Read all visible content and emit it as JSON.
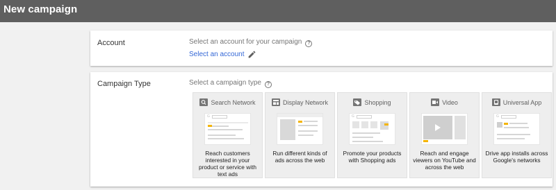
{
  "header": {
    "title": "New campaign"
  },
  "account": {
    "label": "Account",
    "prompt": "Select an account for your campaign",
    "link": "Select an account",
    "edit_icon": "pencil-icon"
  },
  "campaign_type": {
    "label": "Campaign Type",
    "prompt": "Select a campaign type",
    "types": [
      {
        "name": "Search Network",
        "icon": "search-icon",
        "description": "Reach customers interested in your product or service with text ads"
      },
      {
        "name": "Display Network",
        "icon": "display-icon",
        "description": "Run different kinds of ads across the web"
      },
      {
        "name": "Shopping",
        "icon": "shopping-tag-icon",
        "description": "Promote your products with Shopping ads"
      },
      {
        "name": "Video",
        "icon": "video-camera-icon",
        "description": "Reach and engage viewers on YouTube and across the web"
      },
      {
        "name": "Universal App",
        "icon": "app-icon",
        "description": "Drive app installs across Google's networks"
      }
    ]
  },
  "colors": {
    "header_bg": "#5f5f5f",
    "link": "#3367d6",
    "accent_yellow": "#f4b400"
  }
}
